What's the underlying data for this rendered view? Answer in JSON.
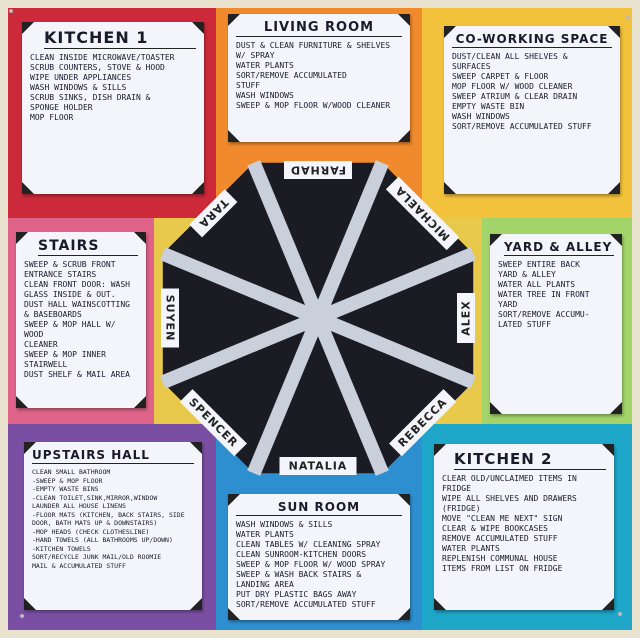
{
  "colors": {
    "kitchen1": "#cc2a3a",
    "living_room": "#f08a2c",
    "coworking": "#f3c23c",
    "stairs": "#e0638a",
    "yard": "#a3d46a",
    "upstairs": "#7a4fa3",
    "sun_room": "#2e8fd0",
    "kitchen2": "#1fa7c9",
    "wheel": "#1b1b24",
    "foil": "#c9d0dc"
  },
  "cards": {
    "kitchen1": {
      "title": "KITCHEN 1",
      "items": [
        "Clean inside microwave/toaster",
        "Scrub counters, stove & hood",
        "Wipe under appliances",
        "Wash windows & sills",
        "Scrub sinks, dish drain &\n   sponge holder",
        "Mop floor"
      ]
    },
    "living_room": {
      "title": "LIVING ROOM",
      "items": [
        "Dust & clean furniture & shelves\n   w/ spray",
        "Water plants",
        "Sort/Remove accumulated\n   stuff",
        "Wash windows",
        "Sweep & mop floor w/wood cleaner"
      ]
    },
    "coworking": {
      "title": "CO-WORKING SPACE",
      "items": [
        "Dust/Clean all shelves &\n   surfaces",
        "Sweep carpet & floor",
        "Mop floor w/ wood cleaner",
        "Sweep atrium & clear drain",
        "Empty waste bin",
        "Wash windows",
        "Sort/Remove accumulated stuff"
      ]
    },
    "stairs": {
      "title": "STAIRS",
      "items": [
        "Sweep & scrub front\n   entrance stairs",
        "Clean front door: wash\n   glass inside & out.",
        "Dust hall wainscotting\n   & baseboards",
        "Sweep & mop hall w/ wood\n   cleaner",
        "Sweep & mop inner\n   stairwell",
        "Dust shelf & mail area"
      ]
    },
    "yard": {
      "title": "YARD & ALLEY",
      "items": [
        "Sweep entire back\n   yard & alley",
        "Water all plants",
        "Water tree in front\n   yard",
        "Sort/Remove accumu-\n   lated stuff"
      ]
    },
    "upstairs": {
      "title": "UPSTAIRS HALL",
      "items": [
        "Clean small bathroom",
        "-Sweep & mop floor",
        "-Empty waste bins",
        "-Clean toilet,sink,mirror,window",
        "Launder all house linens",
        "-Floor mats (kitchen, back stairs, side\n   door, bath mats up & downstairs)",
        "-Mop heads (check clothesline)",
        "-Hand towels (all bathrooms up/down)",
        "-Kitchen towels",
        "Sort/recycle junk mail/old roomie\n   mail & accumulated stuff"
      ]
    },
    "sun_room": {
      "title": "SUN ROOM",
      "items": [
        "Wash windows & sills",
        "Water plants",
        "Clean tables w/ cleaning spray",
        "Clean sunroom-kitchen doors",
        "Sweep & mop floor w/ wood spray",
        "Sweep & wash back stairs &\n   landing area",
        "Put dry plastic bags away",
        "Sort/Remove accumulated stuff"
      ]
    },
    "kitchen2": {
      "title": "KITCHEN 2",
      "items": [
        "Clear old/unclaimed items in fridge",
        "Wipe all shelves and drawers (fridge)",
        "Move \"Clean me next\" sign",
        "Clear & wipe bookcases",
        "Remove accumulated stuff",
        "Water plants",
        "Replenish communal house\n   items from list on fridge"
      ]
    }
  },
  "wheel": {
    "names": [
      "FARHAD",
      "MICHAELA",
      "ALEX",
      "REBECCA",
      "NATALIA",
      "SPENCER",
      "SUYEN",
      "TARA"
    ]
  }
}
